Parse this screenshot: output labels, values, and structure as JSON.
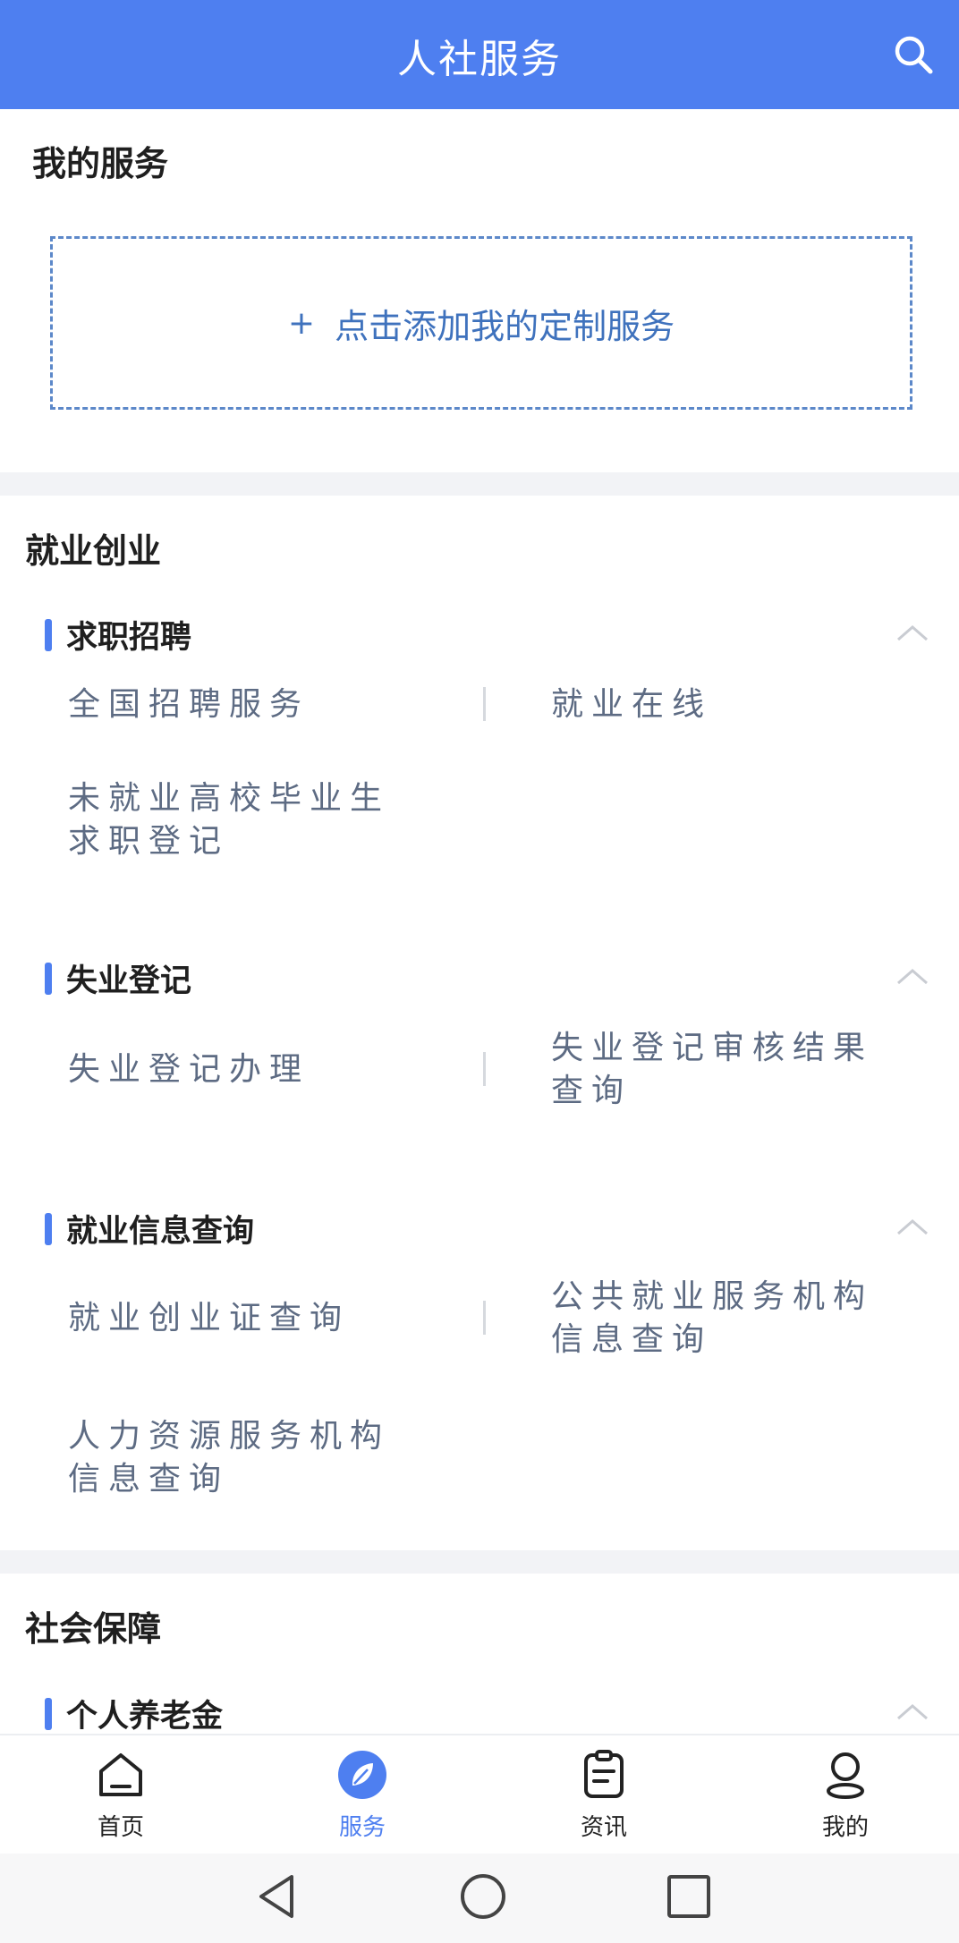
{
  "header": {
    "title": "人社服务"
  },
  "my_services": {
    "title": "我的服务",
    "add_plus": "+",
    "add_label": "点击添加我的定制服务"
  },
  "employment": {
    "title": "就业创业",
    "groups": [
      {
        "title": "求职招聘",
        "items": [
          "全国招聘服务",
          "就业在线",
          "未就业高校毕业生\n求职登记"
        ]
      },
      {
        "title": "失业登记",
        "items": [
          "失业登记办理",
          "失业登记审核结果\n查询"
        ]
      },
      {
        "title": "就业信息查询",
        "items": [
          "就业创业证查询",
          "公共就业服务机构\n信息查询",
          "人力资源服务机构\n信息查询"
        ]
      }
    ]
  },
  "social": {
    "title": "社会保障",
    "groups": [
      {
        "title": "个人养老金"
      }
    ]
  },
  "tabs": [
    {
      "label": "首页",
      "icon": "home-icon"
    },
    {
      "label": "服务",
      "icon": "service-leaf-icon"
    },
    {
      "label": "资讯",
      "icon": "news-icon"
    },
    {
      "label": "我的",
      "icon": "user-icon"
    }
  ],
  "colors": {
    "primary": "#4e7ff0",
    "dashed_border": "#5c88c9",
    "item_text": "#5d6b83",
    "divider": "#f2f3f6"
  }
}
